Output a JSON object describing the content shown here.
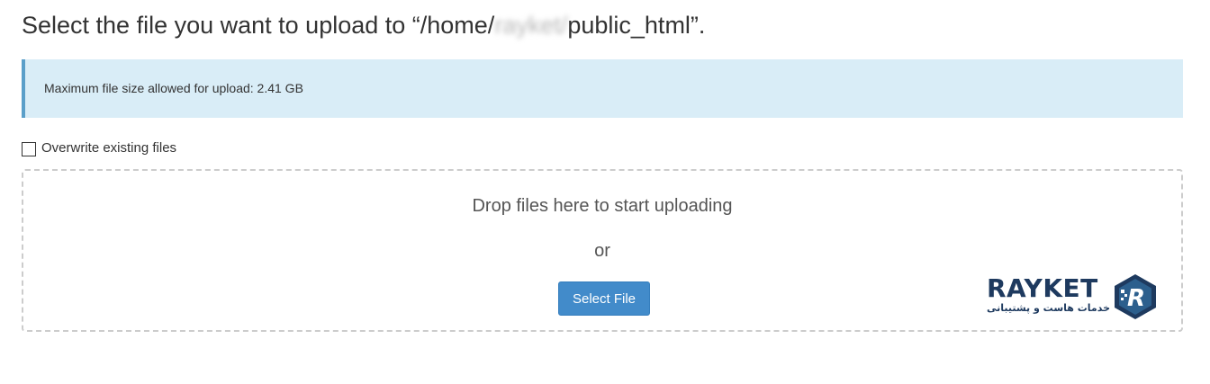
{
  "heading": {
    "prefix": "Select the file you want to upload to “/home/",
    "username": "rayket/",
    "suffix": "public_html”."
  },
  "info": {
    "max_size_text": "Maximum file size allowed for upload: 2.41 GB"
  },
  "overwrite": {
    "label": "Overwrite existing files",
    "checked": false
  },
  "dropzone": {
    "drop_text": "Drop files here to start uploading",
    "or_text": "or",
    "select_button": "Select File"
  },
  "logo": {
    "name": "RAYKET",
    "tagline": "خدمات هاست و پشتیبانی",
    "mark_letter": "R",
    "colors": {
      "primary": "#1e3a5f",
      "accent": "#2c5f8d"
    }
  },
  "colors": {
    "info_bg": "#d9edf7",
    "info_border": "#5a9fc9",
    "button_bg": "#428bca",
    "dropzone_border": "#cccccc"
  }
}
